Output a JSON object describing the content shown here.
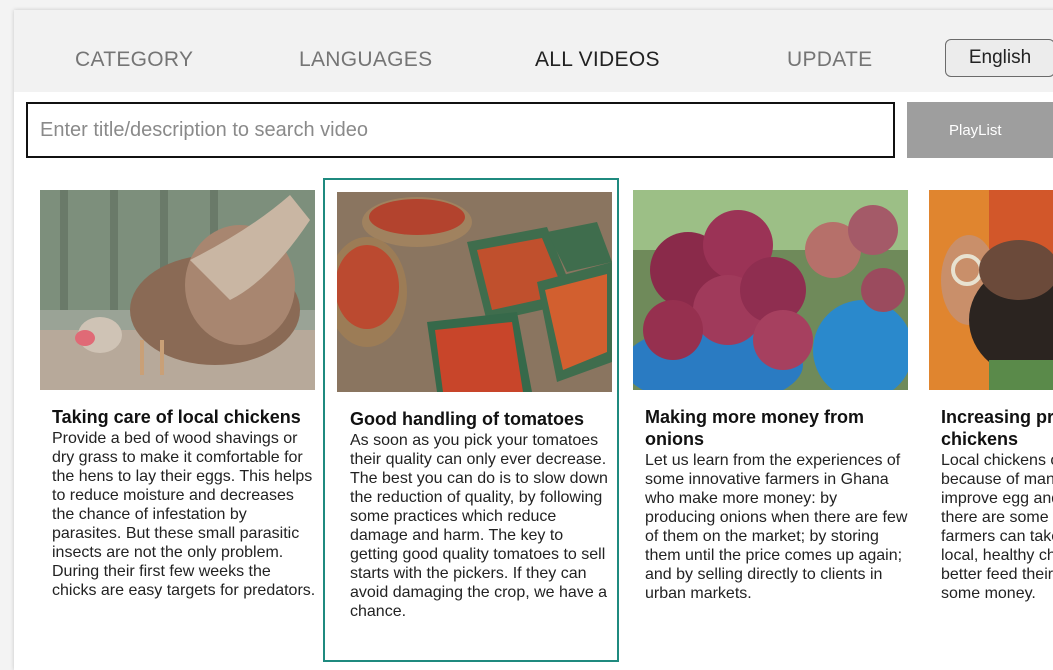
{
  "nav": {
    "category": "CATEGORY",
    "languages": "LANGUAGES",
    "all_videos": "ALL VIDEOS",
    "update": "UPDATE",
    "language_button": "English"
  },
  "search": {
    "placeholder": "Enter title/description to search video"
  },
  "playlist_button": "PlayList",
  "selected_card_index": 1,
  "videos": [
    {
      "title": "Taking care of local chickens",
      "description": "Provide a bed of wood shavings or dry grass to make it comfortable for the hens to lay their eggs. This helps to reduce moisture and decreases the chance of infestation by parasites. But these small parasitic insects are not the only problem. During their first few weeks the chicks are easy targets  for predators.",
      "thumbnail_icon": "chicken-image"
    },
    {
      "title": "Good handling of tomatoes",
      "description": "As soon as you pick your tomatoes their quality can only ever decrease. The best you can do is to slow down the reduction of quality, by following some practices which reduce damage and harm. The key to getting good quality tomatoes to sell starts with the pickers. If they can avoid damaging the crop, we have a chance.",
      "thumbnail_icon": "tomatoes-image"
    },
    {
      "title": "Making more money from onions",
      "description": "Let us learn from the experiences of some innovative farmers in Ghana who make more money: by producing onions when there are few of them on the market; by storing them until the price comes up again; and by selling directly to clients in urban markets.",
      "thumbnail_icon": "onions-image"
    },
    {
      "title": "Increasing production of local chickens",
      "description": "Local chickens often raise few chicks because of many reasons. To improve egg and chick production there are some simple measures farmers can take. By producing more local, healthy chickens, farmers can better feed their families and make some money.",
      "thumbnail_icon": "hand-chicken-image"
    }
  ]
}
